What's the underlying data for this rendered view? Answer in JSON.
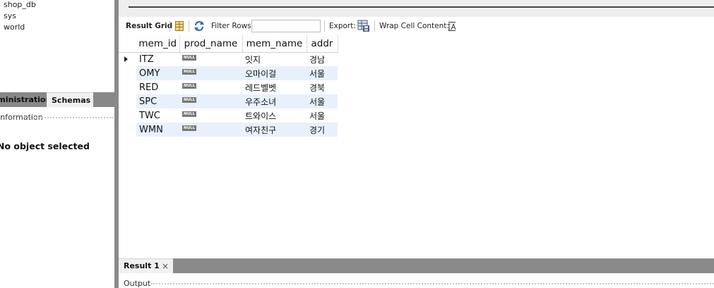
{
  "navigator": {
    "schemas": [
      "shop_db",
      "sys",
      "world"
    ],
    "tabs": {
      "administration": "Administration",
      "schemas": "Schemas"
    },
    "info_label": "Information",
    "no_object": "No object selected"
  },
  "result_toolbar": {
    "result_grid_label": "Result Grid",
    "filter_label": "Filter Rows:",
    "filter_value": "",
    "export_label": "Export:",
    "wrap_label": "Wrap Cell Content:"
  },
  "grid": {
    "columns": [
      "mem_id",
      "prod_name",
      "mem_name",
      "addr"
    ],
    "null_text": "NULL",
    "rows": [
      {
        "mem_id": "ITZ",
        "prod_name": "NULL",
        "mem_name": "잇지",
        "addr": "경남"
      },
      {
        "mem_id": "OMY",
        "prod_name": "NULL",
        "mem_name": "오마이걸",
        "addr": "서울"
      },
      {
        "mem_id": "RED",
        "prod_name": "NULL",
        "mem_name": "레드벨벳",
        "addr": "경북"
      },
      {
        "mem_id": "SPC",
        "prod_name": "NULL",
        "mem_name": "우주소녀",
        "addr": "서울"
      },
      {
        "mem_id": "TWC",
        "prod_name": "NULL",
        "mem_name": "트와이스",
        "addr": "서울"
      },
      {
        "mem_id": "WMN",
        "prod_name": "NULL",
        "mem_name": "여자친구",
        "addr": "경기"
      }
    ]
  },
  "bottom": {
    "result_tab_label": "Result 1",
    "close_symbol": "×",
    "output_label": "Output"
  },
  "colors": {
    "alt_row": "#e8f0fb",
    "splitter": "#8a8a8a",
    "null_badge": "#777777"
  },
  "icons": {
    "grid": "grid-icon",
    "refresh": "refresh-icon",
    "export": "export-icon",
    "wrap": "wrap-text-icon"
  }
}
